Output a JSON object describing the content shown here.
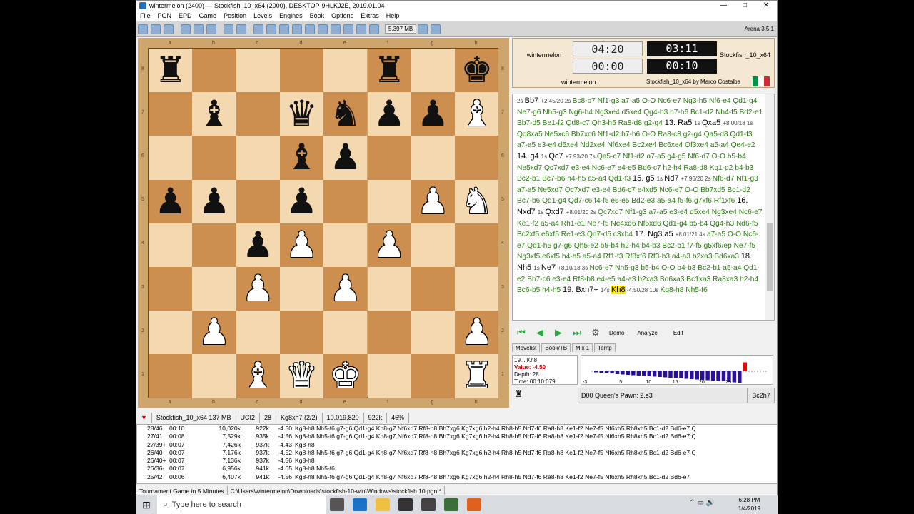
{
  "window": {
    "title": "wintermelon (2400)  — Stockfish_10_x64 (2000),  DESKTOP-9HLKJ2E,  2019.01.04",
    "minimize": "—",
    "maximize": "□",
    "close": "✕"
  },
  "menu": [
    "File",
    "PGN",
    "EPD",
    "Game",
    "Position",
    "Levels",
    "Engines",
    "Book",
    "Options",
    "Extras",
    "Help"
  ],
  "toolbar": {
    "memory": "5.397 MB",
    "version": "Arena 3.5.1"
  },
  "board": {
    "files": [
      "a",
      "b",
      "c",
      "d",
      "e",
      "f",
      "g",
      "h"
    ],
    "ranks": [
      "8",
      "7",
      "6",
      "5",
      "4",
      "3",
      "2",
      "1"
    ],
    "pieces": [
      [
        "bR",
        "",
        "",
        "",
        "",
        "bR",
        "",
        "bK"
      ],
      [
        "",
        "bB",
        "",
        "bQ",
        "bN",
        "bP",
        "bP",
        "wB"
      ],
      [
        "",
        "",
        "",
        "bB",
        "bP",
        "",
        "",
        ""
      ],
      [
        "bP",
        "bP",
        "",
        "bP",
        "",
        "",
        "wP",
        "wN"
      ],
      [
        "",
        "",
        "bP",
        "wP",
        "",
        "wP",
        "",
        ""
      ],
      [
        "",
        "",
        "wP",
        "",
        "wP",
        "",
        "",
        ""
      ],
      [
        "",
        "wP",
        "",
        "",
        "",
        "",
        "",
        "wP"
      ],
      [
        "",
        "",
        "wB",
        "wQ",
        "wK",
        "",
        "",
        "wR"
      ]
    ]
  },
  "clock": {
    "white_name": "wintermelon",
    "white_total": "04:20",
    "white_move": "00:00",
    "black_total": "03:11",
    "black_move": "00:10",
    "black_name": "Stockfish_10_x64",
    "white_label": "wintermelon",
    "engine_label": "Stockfish_10_x64 by Marco Costalba",
    "flag_colors": [
      "#009246",
      "#ffffff",
      "#ce2b37"
    ]
  },
  "movelist": [
    {
      "t": "e",
      "s": "2s "
    },
    {
      "t": "m",
      "s": "Bb7 "
    },
    {
      "t": "e",
      "s": "+2.45/20 2s "
    },
    {
      "t": "v",
      "s": "Bc8-b7 Nf1-g3 a7-a5 O-O Nc6-e7 Ng3-h5 Nf6-e4 Qd1-g4 Ne7-g6 Nh5-g3 Ng6-h4 Ng3xe4 d5xe4 Qg4-h3 h7-h6 Bc1-d2 Nh4-f5 Bd2-e1 Bb7-d5 Be1-f2 Qd8-c7 Qh3-h5 Ra8-d8 g2-g4 "
    },
    {
      "t": "m",
      "s": "13. Ra5 "
    },
    {
      "t": "e",
      "s": "1s "
    },
    {
      "t": "m",
      "s": "Qxa5 "
    },
    {
      "t": "e",
      "s": "+8.00/18 1s "
    },
    {
      "t": "v",
      "s": "Qd8xa5 Ne5xc6 Bb7xc6 Nf1-d2 h7-h6 O-O Ra8-c8 g2-g4 Qa5-d8 Qd1-f3 a7-a5 e3-e4 d5xe4 Nd2xe4 Nf6xe4 Bc2xe4 Bc6xe4 Qf3xe4 a5-a4 Qe4-e2 "
    },
    {
      "t": "m",
      "s": "14. g4 "
    },
    {
      "t": "e",
      "s": "1s "
    },
    {
      "t": "m",
      "s": "Qc7 "
    },
    {
      "t": "e",
      "s": "+7.93/20 7s "
    },
    {
      "t": "v",
      "s": "Qa5-c7 Nf1-d2 a7-a5 g4-g5 Nf6-d7 O-O b5-b4 Ne5xd7 Qc7xd7 e3-e4 Nc6-e7 e4-e5 Bd6-c7 h2-h4 Ra8-d8 Kg1-g2 b4-b3 Bc2-b1 Bc7-b6 h4-h5 a5-a4 Qd1-f3 "
    },
    {
      "t": "m",
      "s": "15. g5 "
    },
    {
      "t": "e",
      "s": "1s "
    },
    {
      "t": "m",
      "s": "Nd7 "
    },
    {
      "t": "e",
      "s": "+7.96/20 2s "
    },
    {
      "t": "v",
      "s": "Nf6-d7 Nf1-g3 a7-a5 Ne5xd7 Qc7xd7 e3-e4 Bd6-c7 e4xd5 Nc6-e7 O-O Bb7xd5 Bc1-d2 Bc7-b6 Qd1-g4 Qd7-c6 f4-f5 e6-e5 Bd2-e3 a5-a4 f5-f6 g7xf6 Rf1xf6 "
    },
    {
      "t": "m",
      "s": "16. Nxd7 "
    },
    {
      "t": "e",
      "s": "1s "
    },
    {
      "t": "m",
      "s": "Qxd7 "
    },
    {
      "t": "e",
      "s": "+8.01/20 2s "
    },
    {
      "t": "v",
      "s": "Qc7xd7 Nf1-g3 a7-a5 e3-e4 d5xe4 Ng3xe4 Nc6-e7 Ke1-f2 a5-a4 Rh1-e1 Ne7-f5 Ne4xd6 Nf5xd6 Qd1-g4 b5-b4 Qg4-h3 Nd6-f5 Bc2xf5 e6xf5 Re1-e3 Qd7-d5 c3xb4 "
    },
    {
      "t": "m",
      "s": "17. Ng3 a5 "
    },
    {
      "t": "e",
      "s": "+8.01/21 4s "
    },
    {
      "t": "v",
      "s": "a7-a5 O-O Nc6-e7 Qd1-h5 g7-g6 Qh5-e2 b5-b4 h2-h4 b4-b3 Bc2-b1 f7-f5 g5xf6/ep Ne7-f5 Ng3xf5 e6xf5 h4-h5 a5-a4 Rf1-f3 Rf8xf6 Rf3-h3 a4-a3 b2xa3 Bd6xa3 "
    },
    {
      "t": "m",
      "s": "18. Nh5 "
    },
    {
      "t": "e",
      "s": "1s "
    },
    {
      "t": "m",
      "s": "Ne7 "
    },
    {
      "t": "e",
      "s": "+8.10/18 3s "
    },
    {
      "t": "v",
      "s": "Nc6-e7 Nh5-g3 b5-b4 O-O b4-b3 Bc2-b1 a5-a4 Qd1-e2 Bb7-c6 e3-e4 Rf8-b8 e4-e5 a4-a3 b2xa3 Bd6xa3 Bc1xa3 Ra8xa3 h2-h4 Bc6-b5 h4-h5 "
    },
    {
      "t": "m",
      "s": "19. Bxh7+ "
    },
    {
      "t": "e",
      "s": "14s "
    },
    {
      "t": "mh",
      "s": "Kh8"
    },
    {
      "t": "e",
      "s": " -4.50/28 10s "
    },
    {
      "t": "v",
      "s": "Kg8-h8 Nh5-f6"
    }
  ],
  "nav": {
    "demo": "Demo",
    "analyze": "Analyze",
    "edit": "Edit"
  },
  "tabs": [
    "Movelist",
    "Book/TB",
    "Mix 1",
    "Temp"
  ],
  "eval": {
    "move": "19... Kh8",
    "value_label": "Value:",
    "value": "-4.50",
    "depth": "Depth: 28",
    "time": "Time: 00:10:079"
  },
  "graph": {
    "ticks": [
      "5",
      "10",
      "15",
      "20",
      "25"
    ],
    "neg_labels": [
      "-3"
    ],
    "bar_color": "#2a0f9a",
    "last_color": "#ff0000",
    "values": [
      -0.3,
      -0.4,
      -0.5,
      -0.6,
      -0.8,
      -0.9,
      -1.0,
      -1.1,
      -1.2,
      -1.3,
      -1.4,
      -1.5,
      -1.6,
      -1.7,
      -1.8,
      -1.9,
      -2.0,
      -2.1,
      -2.2,
      -2.3,
      -2.4,
      -2.5,
      -2.6,
      -2.7,
      -2.8,
      -3.0,
      -3.1,
      -3.2,
      2.5
    ]
  },
  "opening": {
    "name": "D00  Queen's Pawn: 2.e3",
    "last_move": "Bc2h7"
  },
  "engine_bar": [
    "Stockfish_10_x64  137 MB",
    "UCI2",
    "28",
    "Kg8xh7 (2/2)",
    "10,019,820",
    "922k",
    "46%"
  ],
  "analysis": [
    [
      "28/46",
      "00:10",
      "10,020k",
      "922k",
      "-4.50",
      "Kg8-h8 Nh5-f6 g7-g6 Qd1-g4 Kh8-g7 Nf6xd7 Rf8-h8 Bh7xg6 Kg7xg6 h2-h4 Rh8-h5 Nd7-f6 Ra8-h8 Ke1-f2 Ne7-f5 Nf6xh5 Rh8xh5 Bc1-d2 Bd6-e7 Qg4"
    ],
    [
      "27/41",
      "00:08",
      "7,529k",
      "935k",
      "-4.56",
      "Kg8-h8 Nh5-f6 g7-g6 Qd1-g4 Kh8-g7 Nf6xd7 Rf8-h8 Bh7xg6 Kg7xg6 h2-h4 Rh8-h5 Nd7-f6 Ra8-h8 Ke1-f2 Ne7-f5 Nf6xh5 Rh8xh5 Bc1-d2 Bd6-e7 Qg4"
    ],
    [
      "27/39+",
      "00:07",
      "7,426k",
      "937k",
      "-4.43",
      "Kg8-h8"
    ],
    [
      "26/40",
      "00:07",
      "7,176k",
      "937k",
      "-4.52",
      "Kg8-h8 Nh5-f6 g7-g6 Qd1-g4 Kh8-g7 Nf6xd7 Rf8-h8 Bh7xg6 Kg7xg6 h2-h4 Rh8-h5 Nd7-f6 Ra8-h8 Ke1-f2 Ne7-f5 Nf6xh5 Rh8xh5 Bc1-d2 Bd6-e7 Qg4"
    ],
    [
      "26/40+",
      "00:07",
      "7,136k",
      "937k",
      "-4.56",
      "Kg8-h8"
    ],
    [
      "26/36-",
      "00:07",
      "6,956k",
      "941k",
      "-4.65",
      "Kg8-h8 Nh5-f6"
    ],
    [
      "25/42",
      "00:06",
      "6,407k",
      "941k",
      "-4.56",
      "Kg8-h8 Nh5-f6 g7-g6 Qd1-g4 Kh8-g7 Nf6xd7 Rf8-h8 Bh7xg6 Kg7xg6 h2-h4 Rh8-h5 Nd7-f6 Ra8-h8 Ke1-f2 Ne7-f5 Nf6xh5 Rh8xh5 Bc1-d2 Bd6-e7"
    ]
  ],
  "status": {
    "mode": "Tournament Game in 5 Minutes",
    "path": "C:\\Users\\wintermelon\\Downloads\\stockfish-10-win\\Windows\\stockfish 10.pgn *"
  },
  "taskbar": {
    "search": "Type here to search",
    "time": "6:28 PM",
    "date": "1/4/2019"
  }
}
